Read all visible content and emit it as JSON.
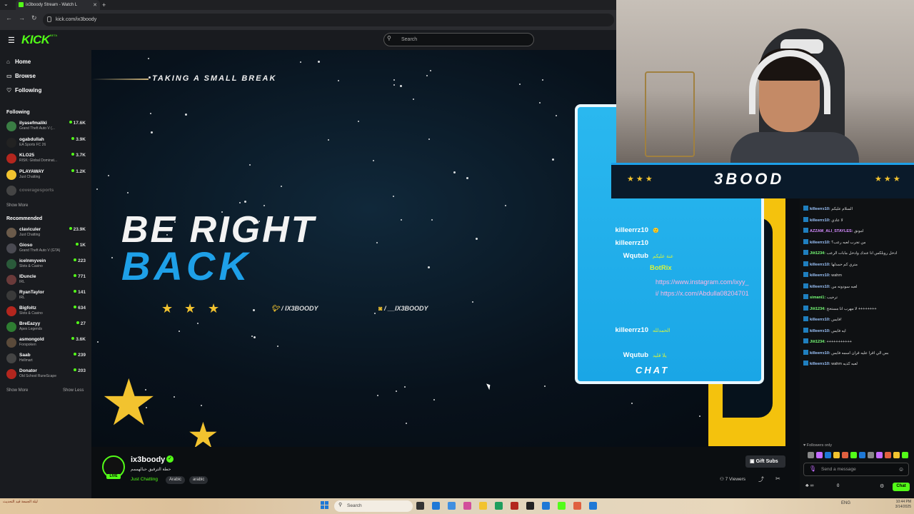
{
  "browser": {
    "tab_title": "ix3boody Stream - Watch L",
    "url": "kick.com/ix3boody",
    "new_tab": "+",
    "tab_close": "✕"
  },
  "header": {
    "logo": "KICK",
    "logo_tag": "BETA",
    "search_placeholder": "Search"
  },
  "sidebar": {
    "nav": [
      {
        "label": "Home",
        "icon": "home-icon"
      },
      {
        "label": "Browse",
        "icon": "browse-icon"
      },
      {
        "label": "Following",
        "icon": "heart-icon"
      }
    ],
    "following_title": "Following",
    "following": [
      {
        "name": "ilyasefmaliki",
        "game": "Grand Theft Auto V (...",
        "viewers": "17.6K",
        "color": "#3a7d44"
      },
      {
        "name": "ogabdullah",
        "game": "EA Sports FC 26",
        "viewers": "3.9K",
        "color": "#222222"
      },
      {
        "name": "KLO25",
        "game": "RISK: Global Dominat...",
        "viewers": "3.7K",
        "color": "#b3261e"
      },
      {
        "name": "PLAYAWAY",
        "game": "Just Chatting",
        "viewers": "1.2K",
        "color": "#f2c32f"
      },
      {
        "name": "coveragesports",
        "game": "",
        "viewers": "",
        "color": "#444444"
      }
    ],
    "show_more_following": "Show More",
    "recommended_title": "Recommended",
    "recommended": [
      {
        "name": "claviculer",
        "game": "Just Chatting",
        "viewers": "23.9K",
        "color": "#6a5a4a"
      },
      {
        "name": "Gioso",
        "game": "Grand Theft Auto V (GTA)",
        "viewers": "1K",
        "color": "#4a4a52"
      },
      {
        "name": "icelnmyvein",
        "game": "Slots & Casino",
        "viewers": "223",
        "color": "#2a5a3a"
      },
      {
        "name": "IDuncle",
        "game": "IRL",
        "viewers": "771",
        "color": "#6a3a3a"
      },
      {
        "name": "RyanTaylor",
        "game": "IRL",
        "viewers": "141",
        "color": "#3a3a3a"
      },
      {
        "name": "Bigfoltz",
        "game": "Slots & Casino",
        "viewers": "634",
        "color": "#b3261e"
      },
      {
        "name": "BreEazyy",
        "game": "Apex Legends",
        "viewers": "27",
        "color": "#2e7d32"
      },
      {
        "name": "asmongold",
        "game": "Forspoken",
        "viewers": "3.6K",
        "color": "#5a4a3a"
      },
      {
        "name": "Saab",
        "game": "Hellmart",
        "viewers": "239",
        "color": "#444444"
      },
      {
        "name": "Donator",
        "game": "Old School RuneScape",
        "viewers": "203",
        "color": "#b3261e"
      }
    ],
    "show_more": "Show More",
    "show_less": "Show Less"
  },
  "stream_overlay": {
    "break_text": "TAKING A SMALL BREAK",
    "be_right": "BE RIGHT",
    "back": "BACK",
    "twitter": "/ IX3BOODY",
    "instagram": "/ __IX3BOODY",
    "chat_label": "CHAT",
    "banner_name": "3BOOD",
    "overlay_chat": [
      {
        "name": "killeerrz10",
        "msg": "🙂"
      },
      {
        "name": "killeerrz10",
        "msg": ""
      },
      {
        "name": "Wqutub",
        "msg": "عنة عليكم"
      }
    ],
    "bot_name": "BotRix",
    "bot_link": "https://www.instagram.com/ixyy_i/ https://x.com/Abdulla08204701",
    "overlay_chat_after": [
      {
        "name": "killeerrz10",
        "msg": "الحمدلله"
      },
      {
        "name": "Wqutub",
        "msg": "يلا قليد"
      }
    ]
  },
  "stream_info": {
    "streamer": "ix3boody",
    "title": "حطة الترقيق حبالهممم",
    "category": "Just Chatting",
    "tags": [
      "Arabic",
      "arabic"
    ],
    "live": "LIVE",
    "gift_subs": "Gift Subs",
    "viewers": "7 Viewers"
  },
  "chat": {
    "messages": [
      {
        "user": "killeerrz10",
        "text": "السلام عليكم",
        "color": "#9ec7ff"
      },
      {
        "user": "killeerrz10",
        "text": "لا عادي",
        "color": "#9ec7ff"
      },
      {
        "user": "AZZAM_ALI_STAYLES",
        "text": "امونق",
        "color": "#d58cff"
      },
      {
        "user": "killeerrz10",
        "text": "من تجرب لعبه رعب؟",
        "color": "#9ec7ff"
      },
      {
        "user": "Jiit1234",
        "text": "ادخل روبلكس انا عندك وادخل مابات الرعب",
        "color": "#77ff77"
      },
      {
        "user": "killeerrz10",
        "text": "متري كم حمدلها",
        "color": "#9ec7ff"
      },
      {
        "user": "killeerrz10",
        "text": "wahm",
        "color": "#9ec7ff"
      },
      {
        "user": "killeerrz10",
        "text": "لعبه سودونه من",
        "color": "#9ec7ff"
      },
      {
        "user": "simani1",
        "text": "ترحيب",
        "color": "#77ff77"
      },
      {
        "user": "Jiit1234",
        "text": "لا مهرب انا مستحح ++++++++",
        "color": "#77ff77"
      },
      {
        "user": "killeerrz10",
        "text": "فايس!",
        "color": "#9ec7ff"
      },
      {
        "user": "killeerrz10",
        "text": "ايه فايس",
        "color": "#9ec7ff"
      },
      {
        "user": "Jiit1234",
        "text": "+++++++++++",
        "color": "#77ff77"
      },
      {
        "user": "killeerrz10",
        "text": "بس الي اقرا عليه قران اسمه فايس",
        "color": "#9ec7ff"
      },
      {
        "user": "killeerrz10",
        "text": "wahm لعبه كذيه",
        "color": "#9ec7ff"
      }
    ],
    "followers_only": "Followers only",
    "send_placeholder": "Send a message",
    "points": "0",
    "chat_button": "Chat"
  },
  "taskbar": {
    "weather": "ليلة الجمعة قيد التحديث",
    "search": "Search",
    "tray": "ENG",
    "clock": "10:44 PM 3/14/2025"
  },
  "colors": {
    "kick_green": "#53fc18",
    "overlay_blue": "#1ea0e8",
    "star_yellow": "#f2c32f"
  }
}
